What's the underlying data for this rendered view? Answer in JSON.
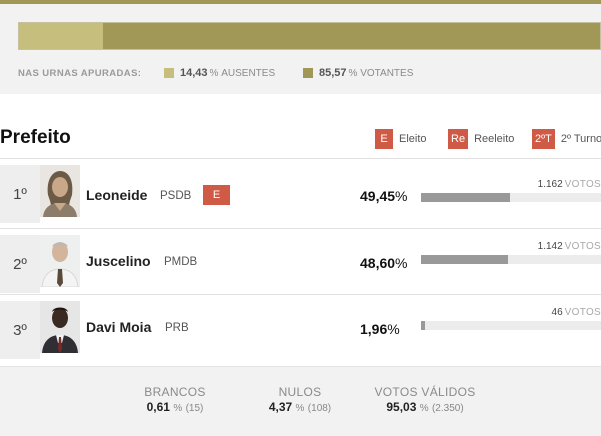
{
  "turnout": {
    "caption": "NAS URNAS APURADAS:",
    "absent": {
      "pct": "14,43",
      "unit": "%",
      "label": "AUSENTES",
      "color": "#c6be7c",
      "fraction": 0.1443
    },
    "voters": {
      "pct": "85,57",
      "unit": "%",
      "label": "VOTANTES",
      "color": "#a19858"
    }
  },
  "section": {
    "title": "Prefeito",
    "legend": [
      {
        "badge": "E",
        "label": "Eleito"
      },
      {
        "badge": "Re",
        "label": "Reeleito"
      },
      {
        "badge": "2ºT",
        "label": "2º Turno"
      }
    ]
  },
  "candidates": [
    {
      "rank": "1º",
      "name": "Leoneide",
      "party": "PSDB",
      "status_badge": "E",
      "pct": "49,45",
      "votes": "1.162",
      "votes_unit": "VOTOS",
      "bar_fraction": 0.4945
    },
    {
      "rank": "2º",
      "name": "Juscelino",
      "party": "PMDB",
      "pct": "48,60",
      "votes": "1.142",
      "votes_unit": "VOTOS",
      "bar_fraction": 0.486
    },
    {
      "rank": "3º",
      "name": "Davi Moia",
      "party": "PRB",
      "pct": "1,96",
      "votes": "46",
      "votes_unit": "VOTOS",
      "bar_fraction": 0.0196
    }
  ],
  "footer": {
    "brancos": {
      "label": "BRANCOS",
      "pct": "0,61",
      "count": "(15)"
    },
    "nulos": {
      "label": "NULOS",
      "pct": "4,37",
      "count": "(108)"
    },
    "validos": {
      "label": "VOTOS VÁLIDOS",
      "pct": "95,03",
      "count": "(2.350)"
    }
  },
  "pct_unit": "%",
  "colors": {
    "accent": "#a19858",
    "badge": "#cf5a45",
    "bar": "#999999"
  }
}
